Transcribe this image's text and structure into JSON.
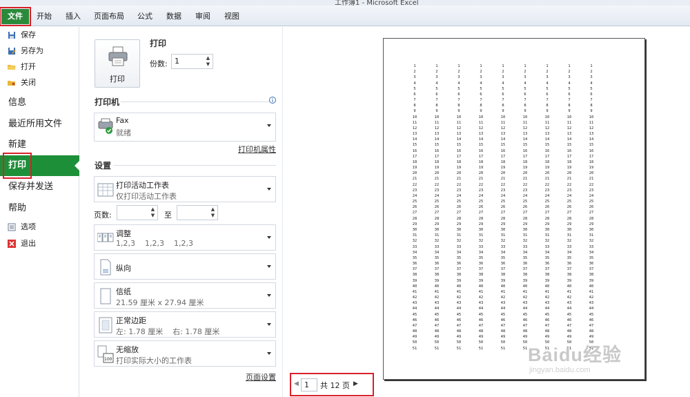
{
  "window": {
    "title": "工作簿1 - Microsoft Excel"
  },
  "tabs": [
    "文件",
    "开始",
    "插入",
    "页面布局",
    "公式",
    "数据",
    "审阅",
    "视图"
  ],
  "nav": {
    "top_items": [
      "保存",
      "另存为",
      "打开",
      "关闭"
    ],
    "info": "信息",
    "recent": "最近所用文件",
    "new": "新建",
    "print": "打印",
    "save_send": "保存并发送",
    "help": "帮助",
    "options": "选项",
    "exit": "退出"
  },
  "print": {
    "heading": "打印",
    "button_label": "打印",
    "copies_label": "份数:",
    "copies_value": "1"
  },
  "printer": {
    "heading": "打印机",
    "name": "Fax",
    "status": "就绪",
    "properties_link": "打印机属性"
  },
  "settings": {
    "heading": "设置",
    "scope_title": "打印活动工作表",
    "scope_desc": "仅打印活动工作表",
    "pages_label": "页数:",
    "to_label": "至",
    "collate_title": "调整",
    "collate_desc": "1,2,3    1,2,3    1,2,3",
    "orientation": "纵向",
    "paper_title": "信纸",
    "paper_desc": "21.59 厘米 x 27.94 厘米",
    "margins_title": "正常边距",
    "margins_desc": "左: 1.78 厘米    右: 1.78 厘米",
    "scaling_title": "无缩放",
    "scaling_desc": "打印实际大小的工作表",
    "page_setup_link": "页面设置"
  },
  "preview": {
    "columns": 9,
    "rows_per_column": 51
  },
  "pager": {
    "current": "1",
    "total_text": "共 12 页"
  },
  "watermark": {
    "logo_text": "Baidu经验",
    "url": "jingyan.baidu.com"
  },
  "colors": {
    "file_tab": "#2a8a3a",
    "print_selected": "#1e8f39",
    "highlight": "#d8202a"
  }
}
